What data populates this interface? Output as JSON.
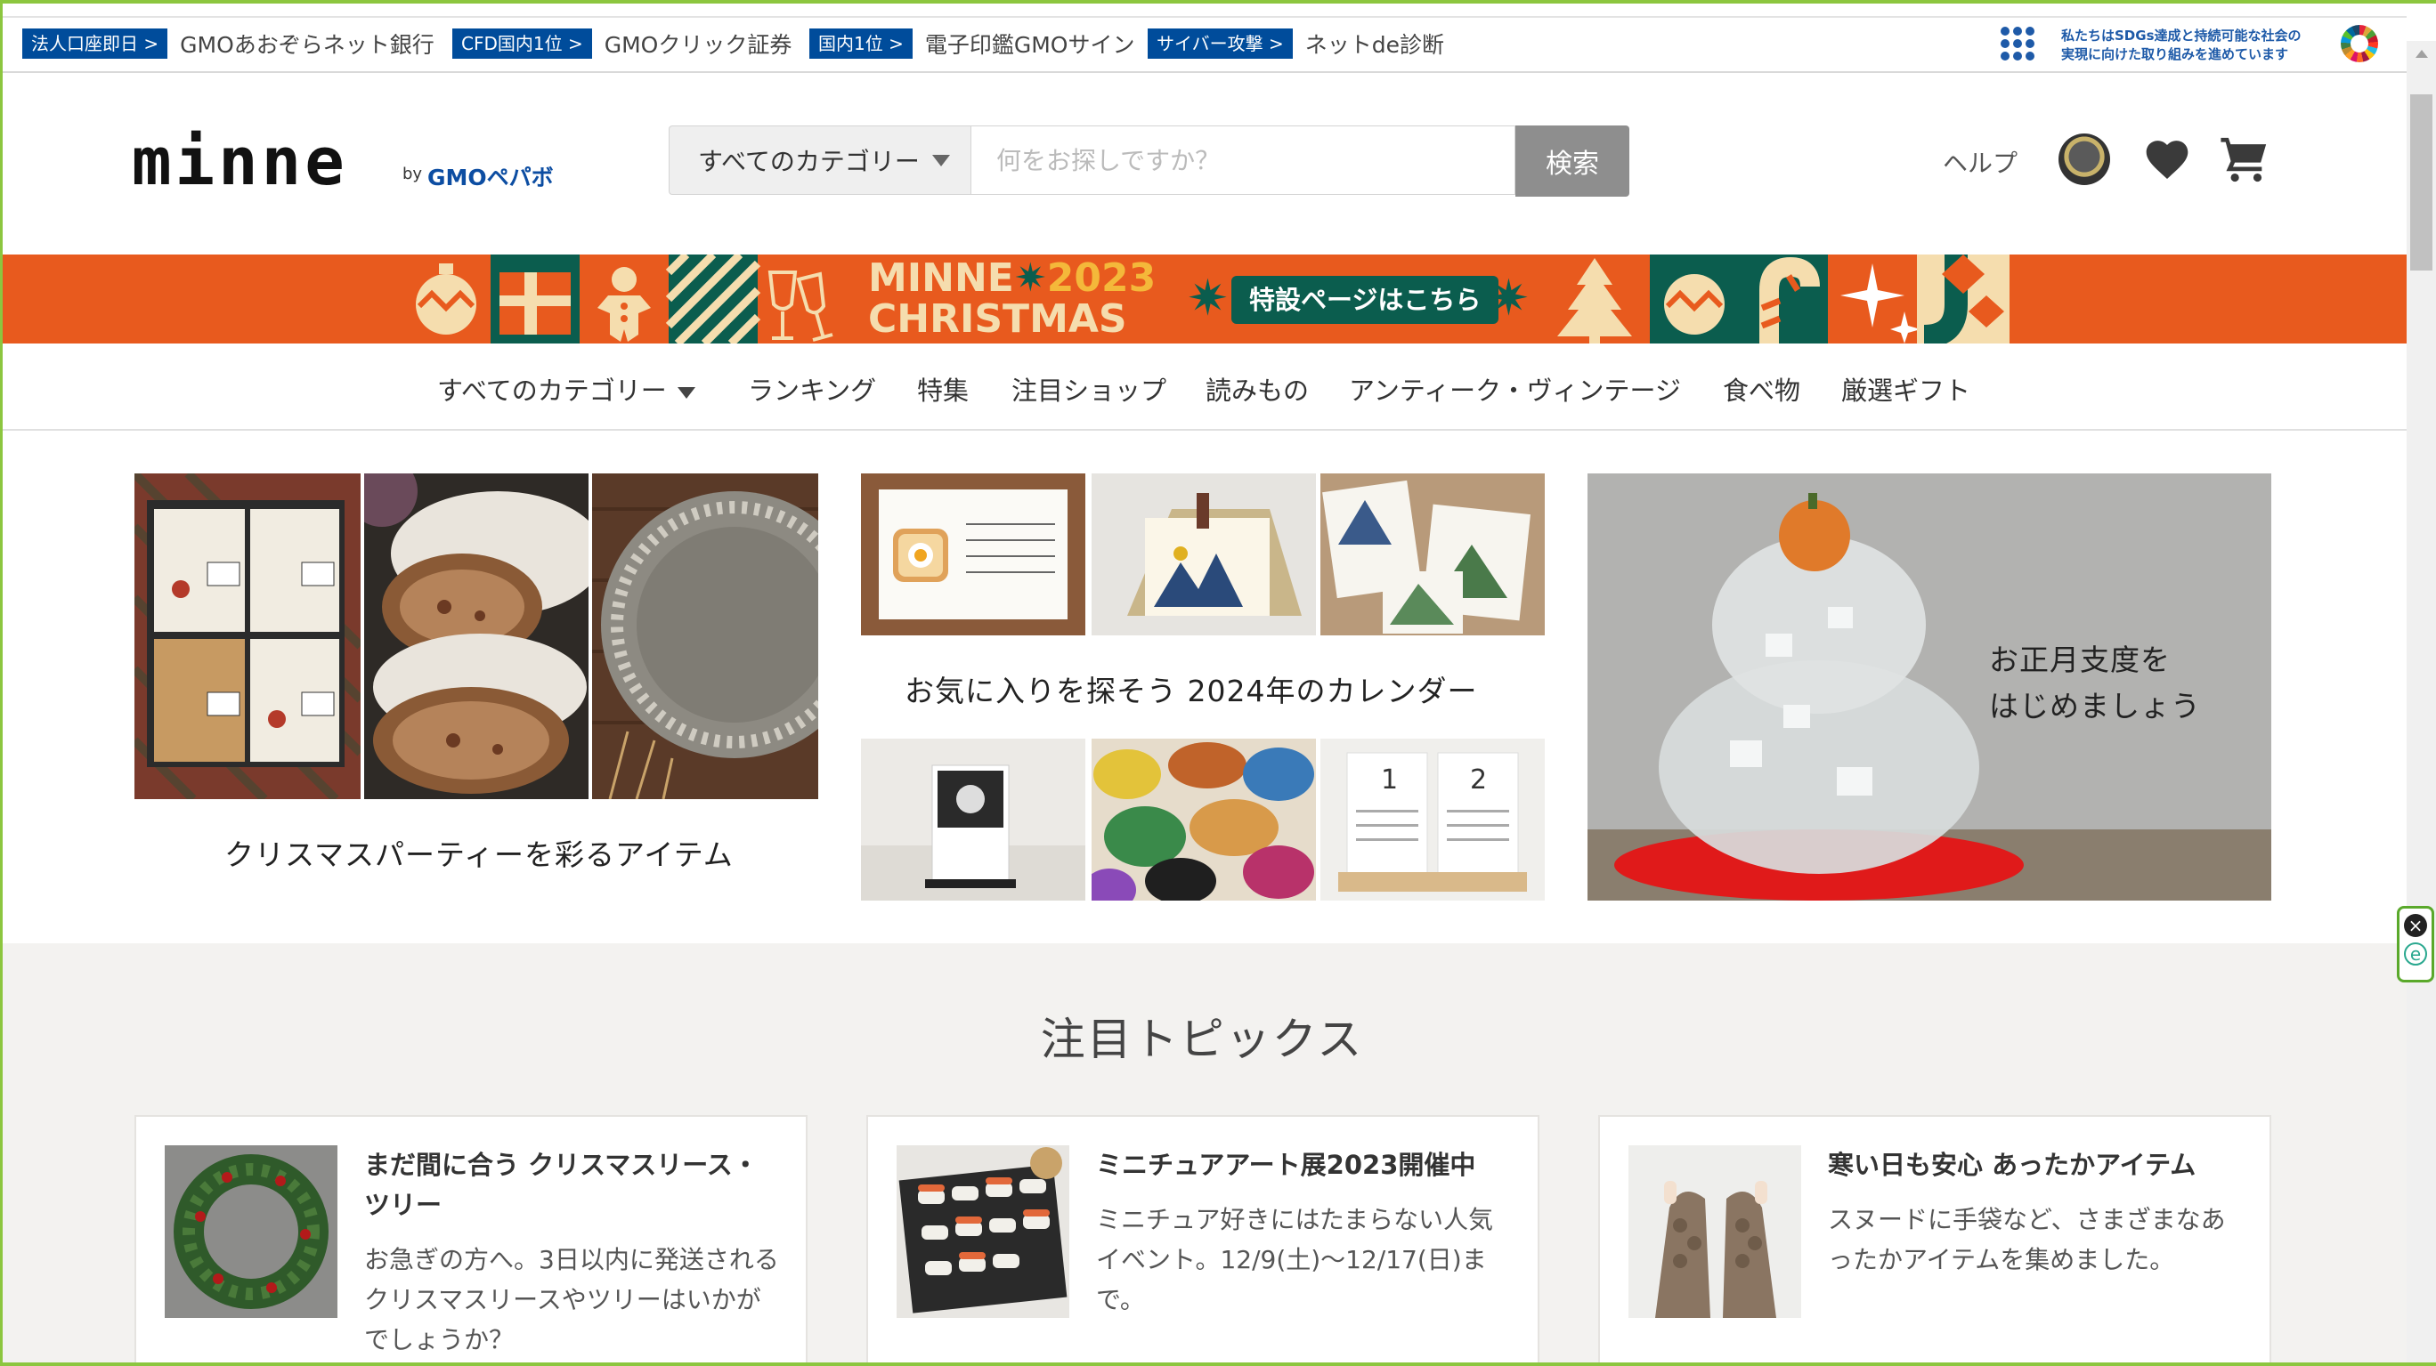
{
  "gmo_bar": {
    "items": [
      {
        "tag": "法人口座即日 >",
        "name": "GMOあおぞらネット銀行"
      },
      {
        "tag": "CFD国内1位 >",
        "name": "GMOクリック証券"
      },
      {
        "tag": "国内1位 >",
        "name": "電子印鑑GMOサイン"
      },
      {
        "tag": "サイバー攻撃 >",
        "name": "ネットde診断"
      }
    ],
    "sdgs_line1": "私たちはSDGs達成と持続可能な社会の",
    "sdgs_line2": "実現に向けた取り組みを進めています"
  },
  "header": {
    "logo": "minne",
    "logo_by": "by",
    "logo_company": "GMOペパボ",
    "category_select": "すべてのカテゴリー",
    "search_placeholder": "何をお探しですか？",
    "search_button": "検索",
    "help": "ヘルプ"
  },
  "banner": {
    "title_line1": "MINNE",
    "title_year": "2023",
    "title_line2": "CHRISTMAS",
    "cta": "特設ページはこちら"
  },
  "nav": {
    "all_categories": "すべてのカテゴリー",
    "items": [
      "ランキング",
      "特集",
      "注目ショップ",
      "読みもの",
      "アンティーク・ヴィンテージ",
      "食べ物",
      "厳選ギフト"
    ]
  },
  "features": {
    "christmas_party": "クリスマスパーティーを彩るアイテム",
    "calendar": "お気に入りを探そう 2024年のカレンダー",
    "new_year_line1": "お正月支度を",
    "new_year_line2": "はじめましょう"
  },
  "topics": {
    "heading": "注目トピックス",
    "cards": [
      {
        "title": "まだ間に合う クリスマスリース・ツリー",
        "desc": "お急ぎの方へ。3日以内に発送されるクリスマスリースやツリーはいかがでしょうか？"
      },
      {
        "title": "ミニチュアアート展2023開催中",
        "desc": "ミニチュア好きにはたまらない人気イベント。12/9(土)〜12/17(日)まで。"
      },
      {
        "title": "寒い日も安心 あったかアイテム",
        "desc": "スヌードに手袋など、さまざまなあったかアイテムを集めました。"
      }
    ]
  },
  "colors": {
    "frame": "#8cc63f",
    "gmo_blue": "#004c9b",
    "banner_orange": "#e85a1e",
    "banner_green": "#0b5d4e",
    "search_button": "#8e8e8e",
    "topics_bg": "#f3f2f0"
  }
}
